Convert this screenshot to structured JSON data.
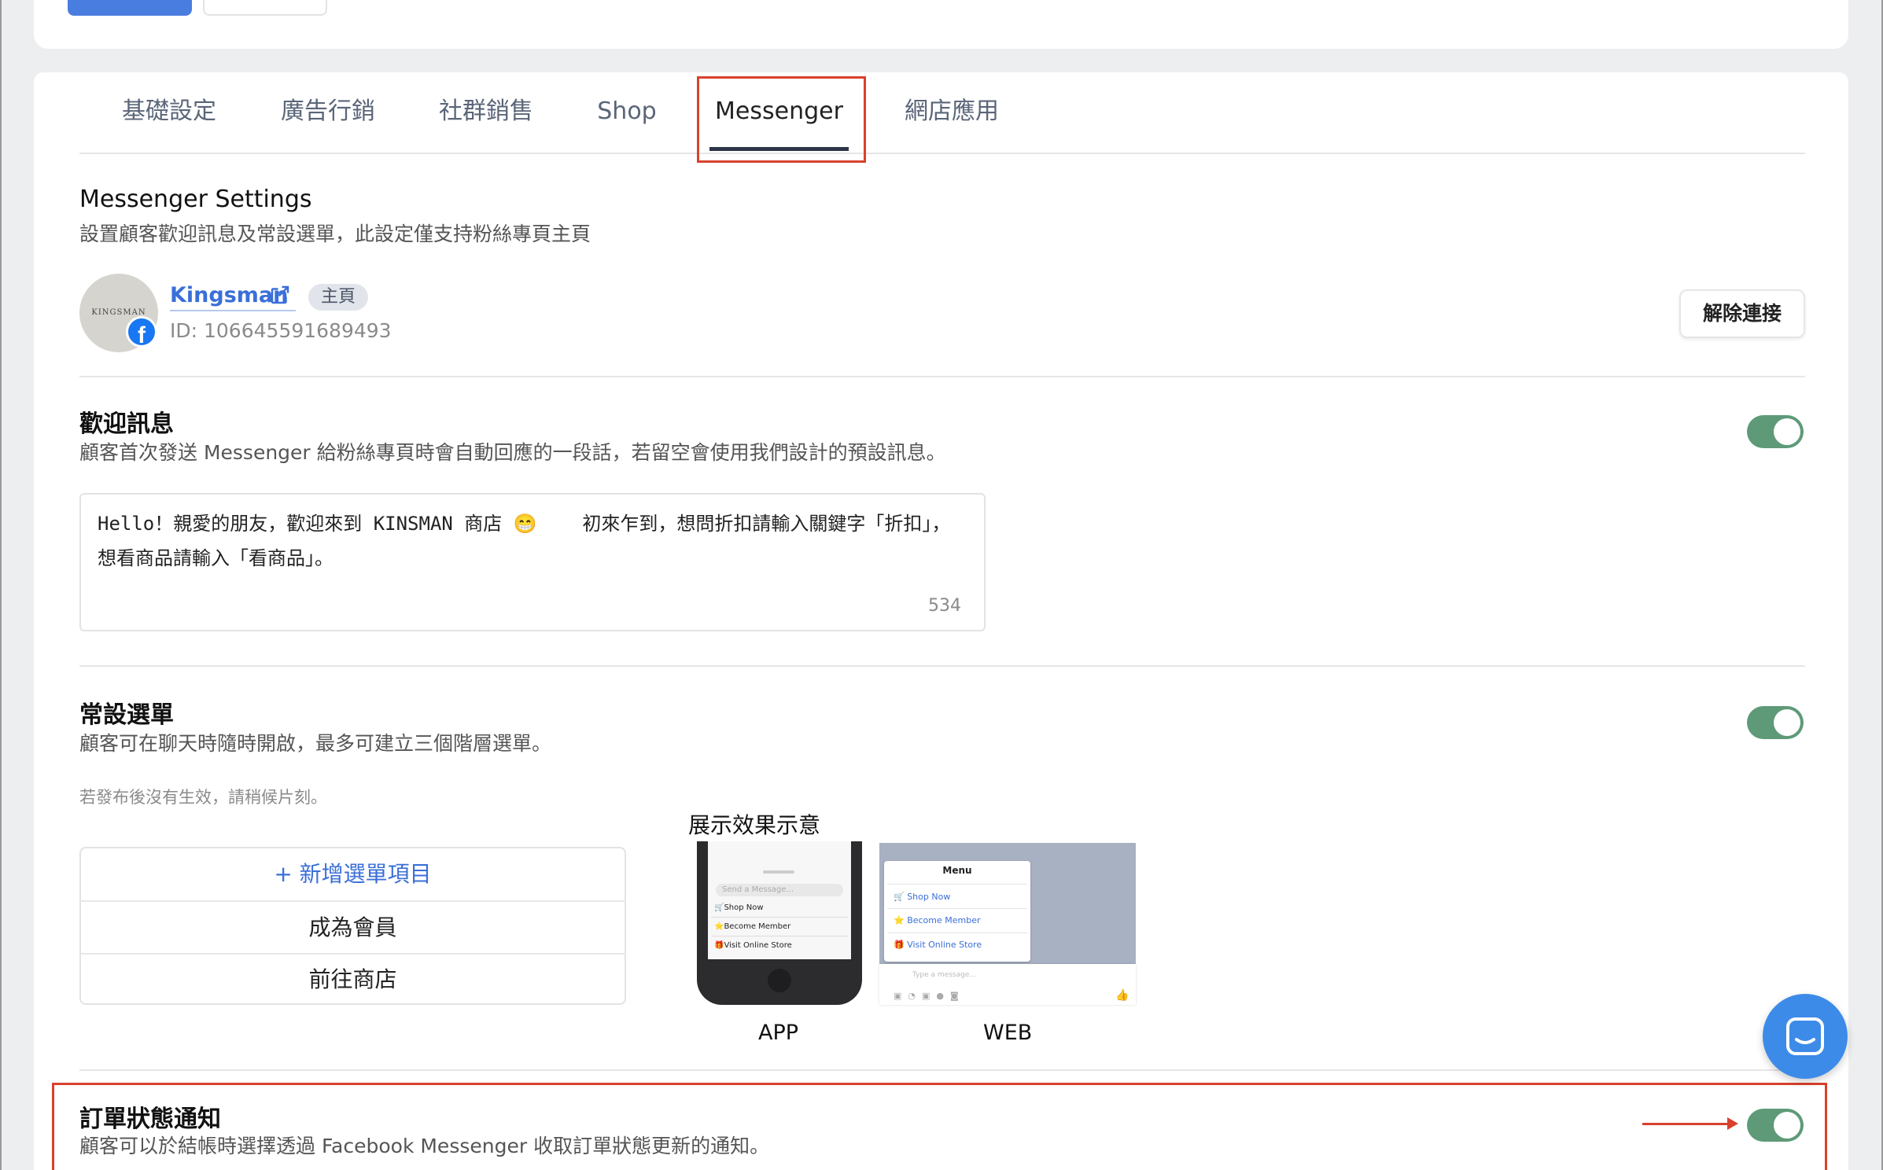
{
  "tabs": [
    {
      "label": "基礎設定"
    },
    {
      "label": "廣告行銷"
    },
    {
      "label": "社群銷售"
    },
    {
      "label": "Shop"
    },
    {
      "label": "Messenger"
    },
    {
      "label": "網店應用"
    }
  ],
  "active_tab": "Messenger",
  "settings": {
    "title": "Messenger Settings",
    "description": "設置顧客歡迎訊息及常設選單，此設定僅支持粉絲專頁主頁"
  },
  "page": {
    "avatar_text": "KINGSMAN",
    "name": "Kingsman",
    "tag": "主頁",
    "id_text": "ID: 106645591689493",
    "disconnect_label": "解除連接"
  },
  "welcome": {
    "title": "歡迎訊息",
    "description": "顧客首次發送 Messenger 給粉絲專頁時會自動回應的一段話，若留空會使用我們設計的預設訊息。",
    "enabled": true,
    "message": "Hello！親愛的朋友，歡迎來到 KINSMAN 商店 😁    初來乍到，想問折扣請輸入關鍵字「折扣」，想看商品請輸入「看商品」。",
    "char_count": "534"
  },
  "persistent_menu": {
    "title": "常設選單",
    "description": "顧客可在聊天時隨時開啟，最多可建立三個階層選單。",
    "note": "若發布後沒有生效，請稍候片刻。",
    "enabled": true,
    "add_label": "+ 新增選單項目",
    "items": [
      "成為會員",
      "前往商店"
    ]
  },
  "preview": {
    "title": "展示效果示意",
    "app_label": "APP",
    "web_label": "WEB",
    "app_send_placeholder": "Send a Message...",
    "app_items": [
      "🛒Shop Now",
      "⭐Become Member",
      "🎁Visit Online Store"
    ],
    "web_menu_title": "Menu",
    "web_items": [
      "🛒 Shop Now",
      "⭐ Become Member",
      "🎁 Visit Online Store"
    ],
    "web_input_placeholder": "Type a message..."
  },
  "order_notify": {
    "title": "訂單狀態通知",
    "description": "顧客可以於結帳時選擇透過 Facebook Messenger 收取訂單狀態更新的通知。",
    "enabled": true
  },
  "colors": {
    "accent": "#3a6fd8",
    "toggle_on": "#5e9a78",
    "highlight": "#d9412c",
    "chat_fab": "#3d8be8"
  }
}
